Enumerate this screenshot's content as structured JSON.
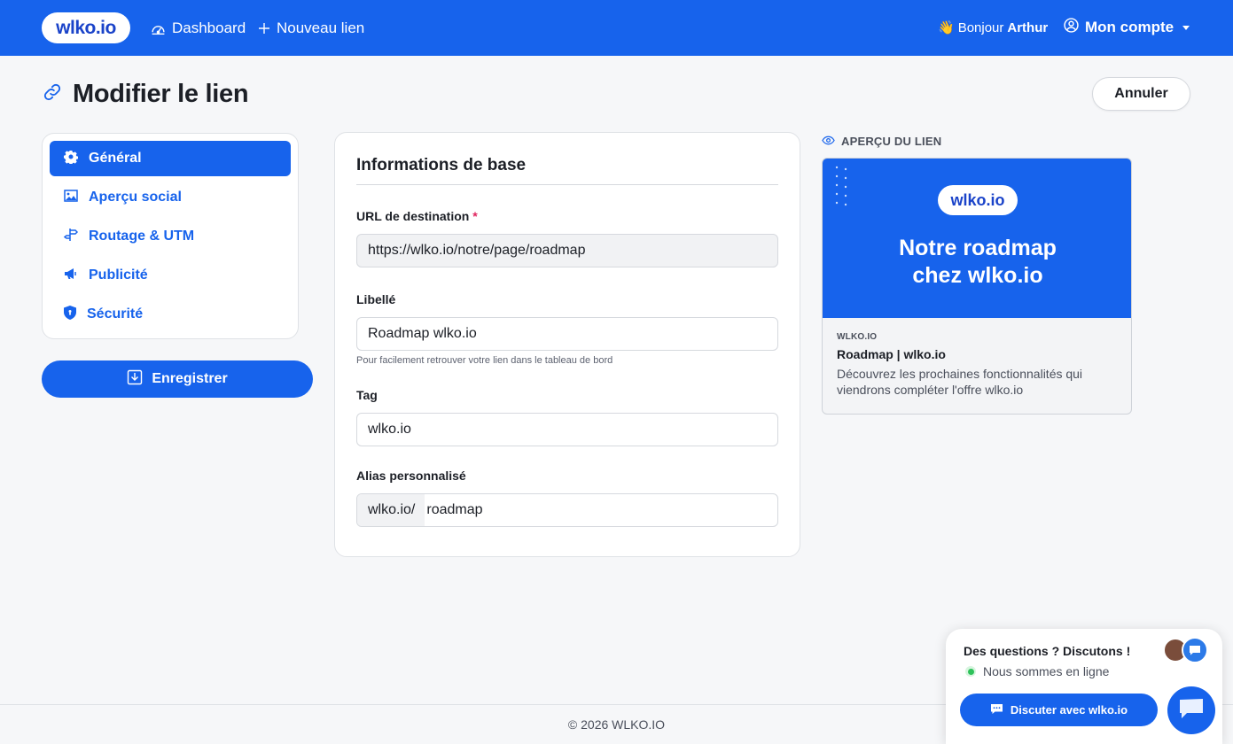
{
  "navbar": {
    "logo": "wlko.io",
    "dashboard_label": "Dashboard",
    "new_link_label": "Nouveau lien",
    "greeting_emoji": "👋",
    "greeting_prefix": "Bonjour",
    "greeting_name": "Arthur",
    "account_label": "Mon compte"
  },
  "header": {
    "title": "Modifier le lien",
    "cancel_label": "Annuler"
  },
  "sidebar": {
    "items": [
      {
        "label": "Général",
        "icon": "gear-icon",
        "active": true
      },
      {
        "label": "Aperçu social",
        "icon": "image-icon",
        "active": false
      },
      {
        "label": "Routage & UTM",
        "icon": "signpost-icon",
        "active": false
      },
      {
        "label": "Publicité",
        "icon": "megaphone-icon",
        "active": false
      },
      {
        "label": "Sécurité",
        "icon": "shield-icon",
        "active": false
      }
    ],
    "save_label": "Enregistrer"
  },
  "form": {
    "section_title": "Informations de base",
    "destination": {
      "label": "URL de destination",
      "required_mark": "*",
      "value": "https://wlko.io/notre/page/roadmap"
    },
    "libelle": {
      "label": "Libellé",
      "value": "Roadmap wlko.io",
      "help": "Pour facilement retrouver votre lien dans le tableau de bord"
    },
    "tag": {
      "label": "Tag",
      "value": "wlko.io"
    },
    "alias": {
      "label": "Alias personnalisé",
      "prefix": "wlko.io/",
      "value": "roadmap"
    }
  },
  "preview": {
    "label": "APERÇU DU LIEN",
    "image_logo": "wlko.io",
    "image_headline_line1": "Notre roadmap",
    "image_headline_line2": "chez wlko.io",
    "domain": "WLKO.IO",
    "title": "Roadmap | wlko.io",
    "description": "Découvrez les prochaines fonctionnalités qui viendrons compléter l'offre wlko.io"
  },
  "footer": {
    "copyright": "© 2026 WLKO.IO"
  },
  "chat": {
    "title": "Des questions ? Discutons !",
    "status": "Nous sommes en ligne",
    "button_label": "Discuter avec wlko.io"
  },
  "colors": {
    "brand": "#1763ec",
    "logo_text": "#1a43c9",
    "online": "#2ec25a",
    "required": "#e0245e"
  }
}
